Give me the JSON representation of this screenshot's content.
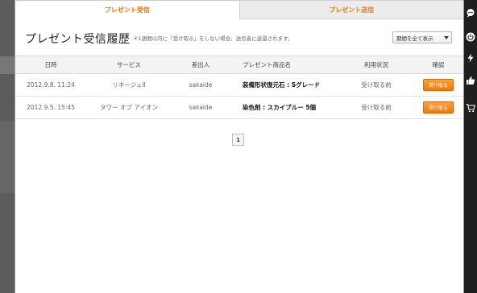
{
  "tabs": [
    {
      "label": "プレゼント受信"
    },
    {
      "label": "プレゼント送信"
    }
  ],
  "header": {
    "title": "プレゼント受信履歴",
    "notice": "＊1週間以内に「受け取る」をしない場合、送信者に返還されます。",
    "filter_selected": "期間を全て表示"
  },
  "table": {
    "columns": [
      "日時",
      "サービス",
      "差出人",
      "プレゼント商品名",
      "利用状況",
      "確認"
    ],
    "rows": [
      {
        "date": "2012.9.8. 11:24",
        "service": "リネージュII",
        "sender": "sakaide",
        "item": "装備形状復元石 : Sグレード",
        "status": "受け取る前",
        "action": "受け取る"
      },
      {
        "date": "2012.9.5. 15:45",
        "service": "タワー オブ アイオン",
        "sender": "sakaide",
        "item": "染色剤 : スカイブルー 5個",
        "status": "受け取る前",
        "action": "受け取る"
      }
    ]
  },
  "pagination": {
    "current": "1"
  },
  "colors": {
    "accent": "#e8780c",
    "button": "#f28b20",
    "rail": "#1f1f1f"
  },
  "rail_icons": [
    "chat-bubble-icon",
    "power-icon",
    "lightning-icon",
    "like-icon",
    "ticket-icon",
    "cart-icon"
  ]
}
